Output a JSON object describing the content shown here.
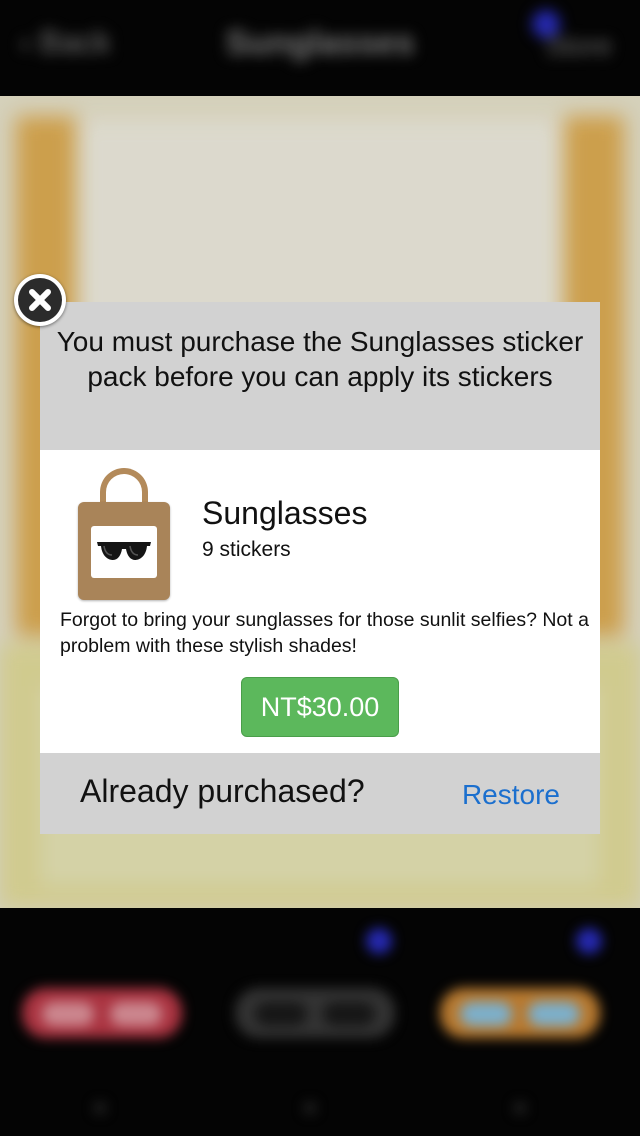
{
  "background": {
    "nav": {
      "back_label": "‹ Back",
      "title": "Sunglasses",
      "right_label": "Store"
    }
  },
  "dialog": {
    "message": "You must purchase the Sunglasses sticker pack before you can apply its stickers",
    "pack": {
      "icon": "shopping-bag-sunglasses-icon",
      "name": "Sunglasses",
      "count": "9 stickers",
      "description": "Forgot to bring your sunglasses for those sunlit selfies?  Not a problem with these stylish shades!"
    },
    "price_label": "NT$30.00",
    "footer": {
      "label": "Already purchased?",
      "restore_label": "Restore"
    },
    "close_icon": "close-x-icon"
  },
  "colors": {
    "price_button": "#5cb85c",
    "restore_link": "#1b6fce",
    "dialog_gray": "#d2d2d2"
  }
}
